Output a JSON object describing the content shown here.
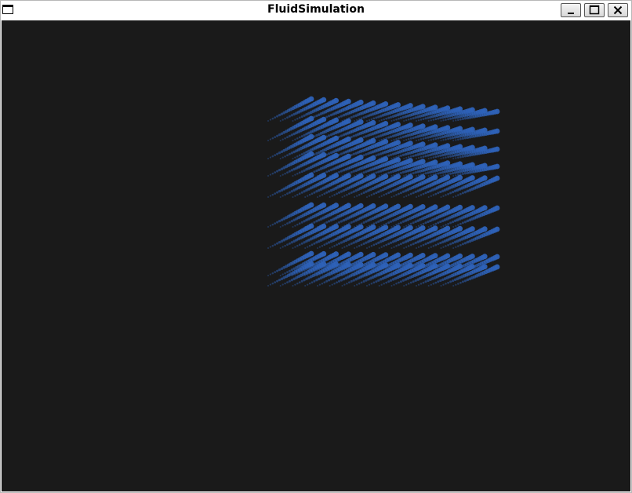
{
  "window": {
    "title": "FluidSimulation",
    "icon": "window-icon",
    "controls": [
      "minimize-icon",
      "maximize-icon",
      "close-icon"
    ]
  },
  "scene": {
    "content": "particle-grid",
    "background_color": "#1a1a1a",
    "particle_color": "#2e62b8"
  }
}
